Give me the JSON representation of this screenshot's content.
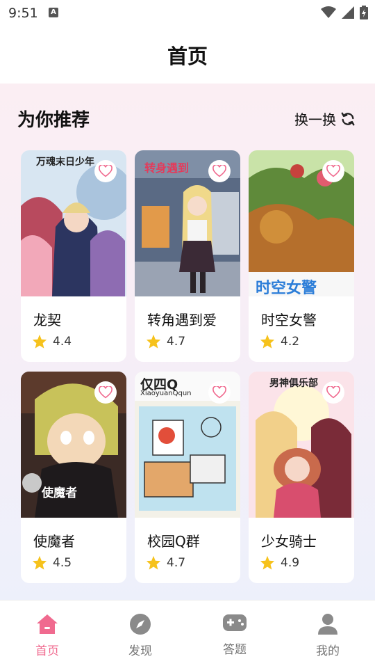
{
  "status": {
    "time": "9:51",
    "notif_letter": "A"
  },
  "header": {
    "title": "首页"
  },
  "section": {
    "title": "为你推荐",
    "refresh_label": "换一换"
  },
  "cards": [
    {
      "name": "龙契",
      "rating": "4.4",
      "cover_text": "万魂末日少年"
    },
    {
      "name": "转角遇到爱",
      "rating": "4.7",
      "cover_text": "转身遇到"
    },
    {
      "name": "时空女警",
      "rating": "4.2",
      "cover_text": "时空女警"
    },
    {
      "name": "使魔者",
      "rating": "4.5",
      "cover_text": "使魔者"
    },
    {
      "name": "校园Q群",
      "rating": "4.7",
      "cover_text": "XiaoyuanQqun"
    },
    {
      "name": "少女骑士",
      "rating": "4.9",
      "cover_text": "男神俱乐部"
    }
  ],
  "tabs": [
    {
      "label": "首页",
      "icon": "home-icon",
      "active": true
    },
    {
      "label": "发现",
      "icon": "compass-icon",
      "active": false
    },
    {
      "label": "答题",
      "icon": "gamepad-icon",
      "active": false
    },
    {
      "label": "我的",
      "icon": "user-icon",
      "active": false
    }
  ],
  "colors": {
    "accent": "#f06a8f",
    "star": "#f6c21c",
    "heart": "#f06a8f"
  }
}
